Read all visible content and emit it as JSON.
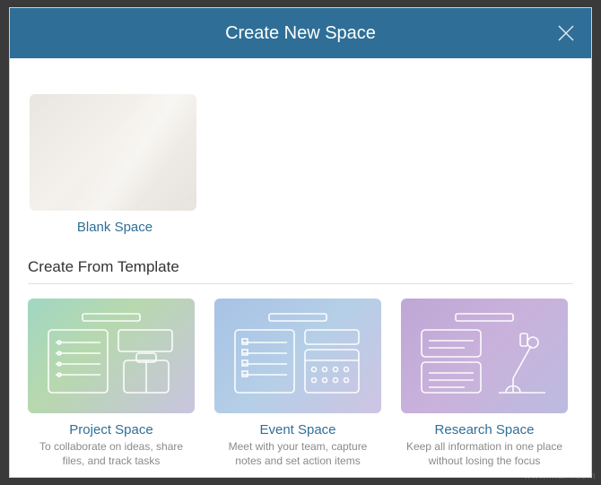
{
  "header": {
    "title": "Create New Space"
  },
  "blank": {
    "title": "Blank Space"
  },
  "templates": {
    "section_title": "Create From Template",
    "items": [
      {
        "id": "project",
        "title": "Project Space",
        "desc": "To collaborate on ideas, share files, and track tasks"
      },
      {
        "id": "event",
        "title": "Event Space",
        "desc": "Meet with your team, capture notes and set action items"
      },
      {
        "id": "research",
        "title": "Research Space",
        "desc": "Keep all information in one place without losing the focus"
      }
    ]
  },
  "watermark": "www.iham.com"
}
